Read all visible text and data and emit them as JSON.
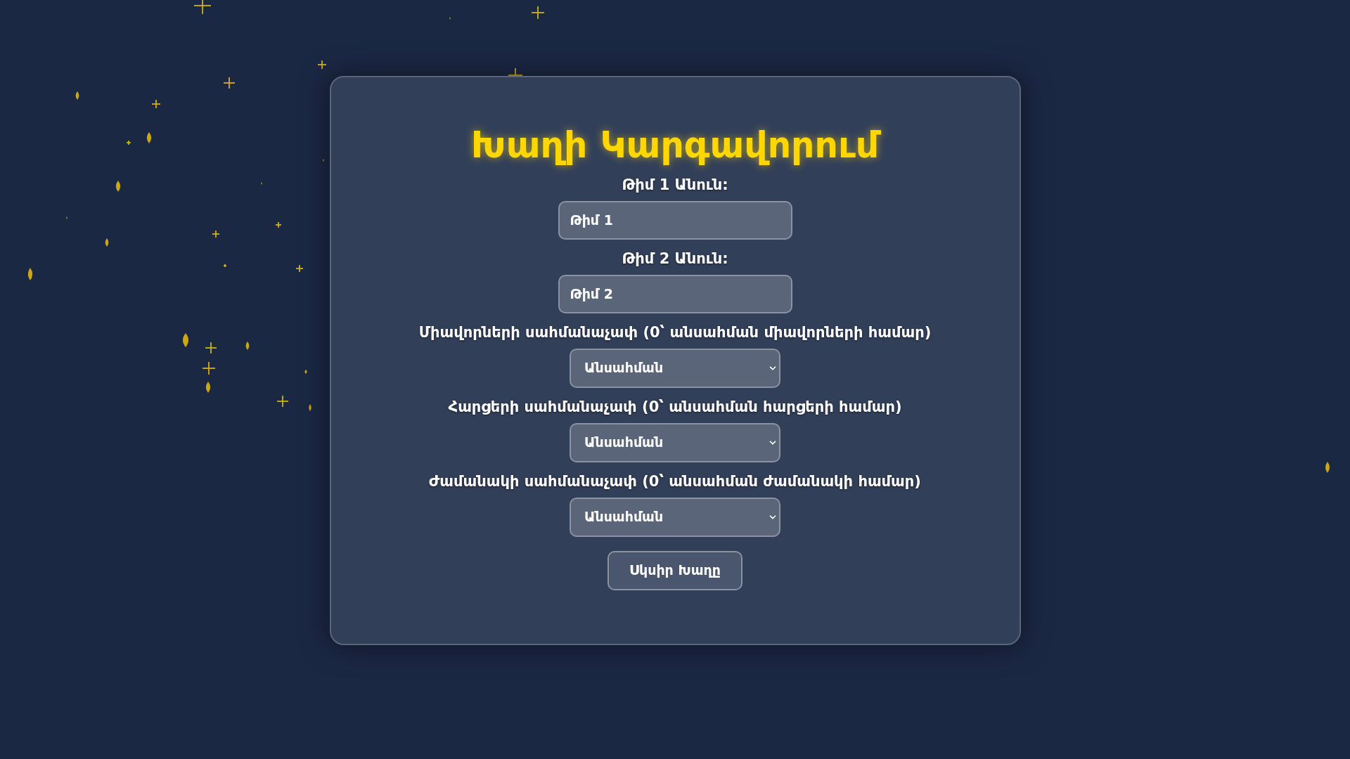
{
  "title": "Խաղի Կարգավորում",
  "fields": [
    {
      "kind": "text",
      "label": "Թիմ 1 Անուն:",
      "value": "Թիմ 1"
    },
    {
      "kind": "text",
      "label": "Թիմ 2 Անուն:",
      "value": "Թիմ 2"
    },
    {
      "kind": "select",
      "label": "Միավորների սահմանաչափ (0՝ անսահման միավորների համար)",
      "value": "Անսահման"
    },
    {
      "kind": "select",
      "label": "Հարցերի սահմանաչափ (0՝ անսահման հարցերի համար)",
      "value": "Անսահման"
    },
    {
      "kind": "select",
      "label": "Ժամանակի սահմանաչափ (0՝ անսահման ժամանակի համար)",
      "value": "Անսահման"
    }
  ],
  "start_button": "Սկսիր Խաղը"
}
